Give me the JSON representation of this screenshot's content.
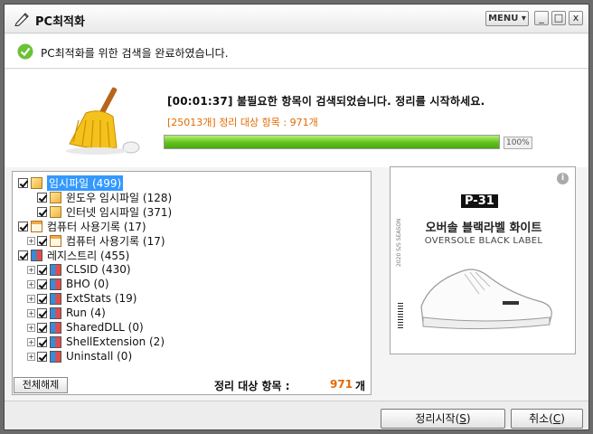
{
  "window": {
    "title": "PC최적화",
    "menu_label": "MENU ▾",
    "minimize": "_",
    "maximize": "□",
    "close": "x"
  },
  "status": {
    "message": "PC최적화를 위한 검색을 완료하였습니다."
  },
  "scan": {
    "result_line": "[00:01:37]  불필요한 항목이 검색되었습니다. 정리를 시작하세요.",
    "count_line": "[25013개] 정리 대상 항목 : 971개",
    "progress_percent": 100,
    "progress_label": "100%"
  },
  "tree": {
    "items": [
      {
        "label": "임시파일 (499)",
        "level": 0,
        "icon": "folder-icon",
        "selected": true
      },
      {
        "label": "윈도우 임시파일 (128)",
        "level": 1,
        "icon": "folder-icon"
      },
      {
        "label": "인터넷 임시파일 (371)",
        "level": 1,
        "icon": "folder-icon"
      },
      {
        "label": "컴퓨터 사용기록 (17)",
        "level": 0,
        "icon": "document-icon"
      },
      {
        "label": "컴퓨터 사용기록 (17)",
        "level": 1,
        "icon": "document-icon",
        "expander": "+"
      },
      {
        "label": "레지스트리 (455)",
        "level": 0,
        "icon": "registry-icon"
      },
      {
        "label": "CLSID (430)",
        "level": 1,
        "icon": "registry-icon",
        "expander": "+"
      },
      {
        "label": "BHO (0)",
        "level": 1,
        "icon": "registry-icon",
        "expander": "+"
      },
      {
        "label": "ExtStats (19)",
        "level": 1,
        "icon": "registry-icon",
        "expander": "+"
      },
      {
        "label": "Run (4)",
        "level": 1,
        "icon": "registry-icon",
        "expander": "+"
      },
      {
        "label": "SharedDLL (0)",
        "level": 1,
        "icon": "registry-icon",
        "expander": "+"
      },
      {
        "label": "ShellExtension (2)",
        "level": 1,
        "icon": "registry-icon",
        "expander": "+"
      },
      {
        "label": "Uninstall (0)",
        "level": 1,
        "icon": "registry-icon",
        "expander": "+"
      }
    ],
    "deselect_all": "전체해제",
    "summary_label": "정리 대상 항목 :",
    "summary_count": "971",
    "summary_unit": "개"
  },
  "ad": {
    "badge": "P-31",
    "title": "오버솔 블랙라벨 화이트",
    "subtitle": "OVERSOLE BLACK LABEL",
    "side_text": "2020 S/S SEASON",
    "info": "i"
  },
  "buttons": {
    "start_prefix": "정리시작(",
    "start_key": "S",
    "start_suffix": ")",
    "cancel_prefix": "취소(",
    "cancel_key": "C",
    "cancel_suffix": ")"
  }
}
